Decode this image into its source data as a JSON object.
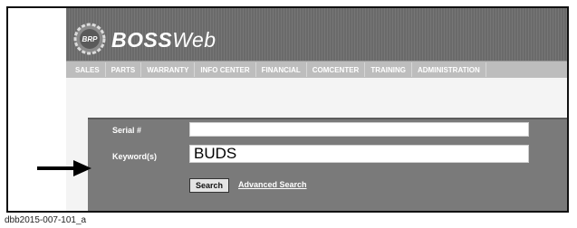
{
  "app": {
    "brand_bold": "BOSS",
    "brand_light": "Web",
    "logo_badge": "BRP"
  },
  "nav": {
    "tabs": [
      {
        "label": "SALES"
      },
      {
        "label": "PARTS"
      },
      {
        "label": "WARRANTY"
      },
      {
        "label": "INFO CENTER"
      },
      {
        "label": "FINANCIAL"
      },
      {
        "label": "COMCENTER"
      },
      {
        "label": "TRAINING"
      },
      {
        "label": "ADMINISTRATION"
      }
    ]
  },
  "search": {
    "serial_label": "Serial #",
    "serial_value": "",
    "keyword_label": "Keyword(s)",
    "keyword_value": "BUDS",
    "search_button": "Search",
    "advanced_link": "Advanced Search"
  },
  "caption": "dbb2015-007-101_a",
  "colors": {
    "header": "#6a6a6a",
    "nav": "#bdbdbd",
    "panel": "#7a7a7a"
  }
}
